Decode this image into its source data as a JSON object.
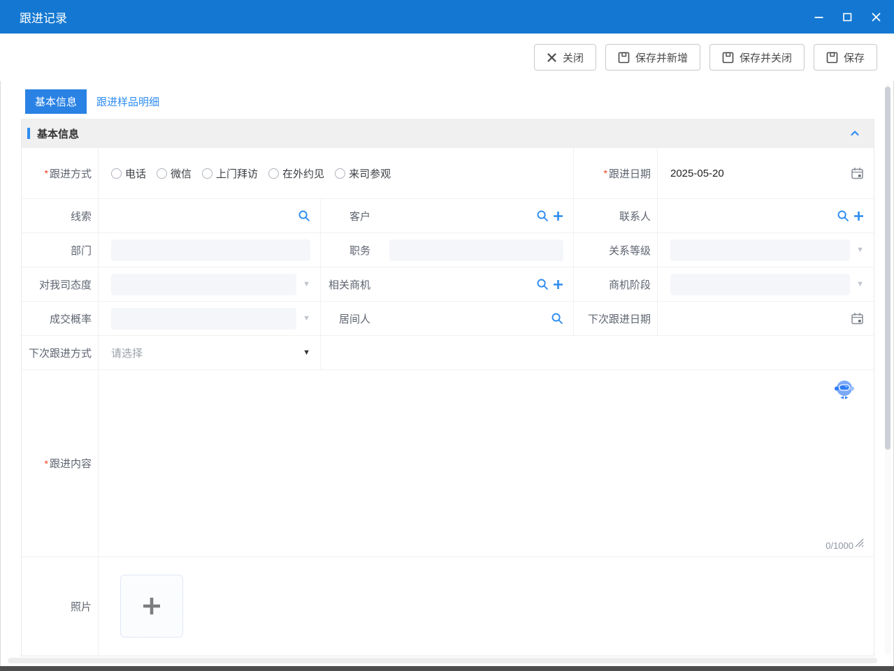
{
  "window": {
    "title": "跟进记录",
    "controls": [
      "minimize-icon",
      "maximize-icon",
      "close-icon"
    ]
  },
  "colors": {
    "titlebar": "#1478d2",
    "accent": "#2d8cf0",
    "required": "#ed4014",
    "disabled_field_bg": "#f5f6fa"
  },
  "toolbar": {
    "buttons": [
      {
        "label": "关闭",
        "icon": "close-icon"
      },
      {
        "label": "保存并新增",
        "icon": "save-icon"
      },
      {
        "label": "保存并关闭",
        "icon": "save-icon"
      },
      {
        "label": "保存",
        "icon": "save-icon"
      }
    ]
  },
  "tabs": [
    {
      "label": "基本信息",
      "active": true
    },
    {
      "label": "跟进样品明细",
      "active": false
    }
  ],
  "section": {
    "title": "基本信息"
  },
  "ui": {
    "required_mark": "*"
  },
  "form": {
    "follow_method": {
      "label": "跟进方式",
      "required": true,
      "options": [
        "电话",
        "微信",
        "上门拜访",
        "在外约见",
        "来司参观"
      ],
      "selected": ""
    },
    "follow_date": {
      "label": "跟进日期",
      "required": true,
      "value": "2025-05-20"
    },
    "lead": {
      "label": "线索",
      "value": ""
    },
    "customer": {
      "label": "客户",
      "value": ""
    },
    "contact": {
      "label": "联系人",
      "value": ""
    },
    "department": {
      "label": "部门",
      "value": "",
      "disabled": true
    },
    "position": {
      "label": "职务",
      "value": "",
      "disabled": true
    },
    "relation_level": {
      "label": "关系等级",
      "value": "",
      "disabled": true
    },
    "attitude": {
      "label": "对我司态度",
      "value": "",
      "disabled": true
    },
    "opportunity": {
      "label": "相关商机",
      "value": ""
    },
    "opportunity_stage": {
      "label": "商机阶段",
      "value": "",
      "disabled": true
    },
    "deal_probability": {
      "label": "成交概率",
      "value": "",
      "disabled": true
    },
    "intermediary": {
      "label": "居间人",
      "value": ""
    },
    "next_follow_date": {
      "label": "下次跟进日期",
      "value": ""
    },
    "next_follow_method": {
      "label": "下次跟进方式",
      "placeholder": "请选择",
      "value": ""
    },
    "follow_content": {
      "label": "跟进内容",
      "required": true,
      "value": "",
      "counter": "0/1000"
    },
    "photo": {
      "label": "照片"
    }
  }
}
